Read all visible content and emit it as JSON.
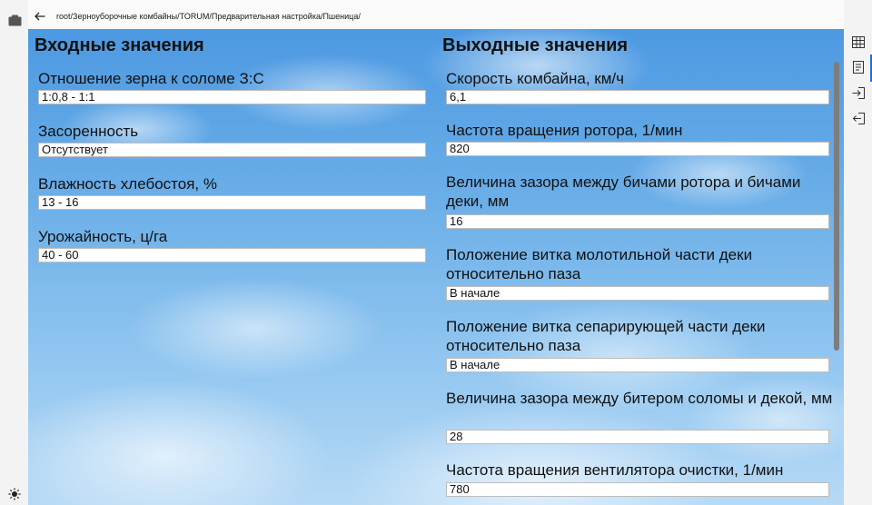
{
  "path": "root/Зерноуборочные комбайны/TORUM/Предварительная настройка/Пшеница/",
  "input_section": {
    "title": "Входные значения",
    "fields": [
      {
        "label": "Отношение зерна к соломе З:С",
        "value": "1:0,8 - 1:1"
      },
      {
        "label": "Засоренность",
        "value": "Отсутствует"
      },
      {
        "label": "Влажность хлебостоя, %",
        "value": "13 - 16"
      },
      {
        "label": "Урожайность, ц/га",
        "value": "40 - 60"
      }
    ]
  },
  "output_section": {
    "title": "Выходные значения",
    "fields": [
      {
        "label": "Скорость комбайна, км/ч",
        "value": "6,1"
      },
      {
        "label": "Частота вращения ротора, 1/мин",
        "value": "820"
      },
      {
        "label": "Величина зазора между бичами ротора и бичами деки, мм",
        "value": "16"
      },
      {
        "label": "Положение витка молотильной части деки относительно паза",
        "value": "В начале"
      },
      {
        "label": "Положение витка сепарирующей части деки относительно паза",
        "value": "В начале"
      },
      {
        "label": "Величина зазора между битером соломы и декой, мм",
        "value": "28"
      },
      {
        "label": "Частота вращения вентилятора очистки, 1/мин",
        "value": "780"
      }
    ]
  },
  "icons": {
    "left_top": "folder-icon",
    "left_bottom": "sun-icon",
    "back": "arrow-left-icon",
    "right": [
      "table-icon",
      "notes-icon",
      "login-icon",
      "logout-icon"
    ]
  },
  "colors": {
    "accent": "#1f6fd1",
    "sky_top": "#4d99e2",
    "sky_bottom": "#b6d9f5"
  }
}
